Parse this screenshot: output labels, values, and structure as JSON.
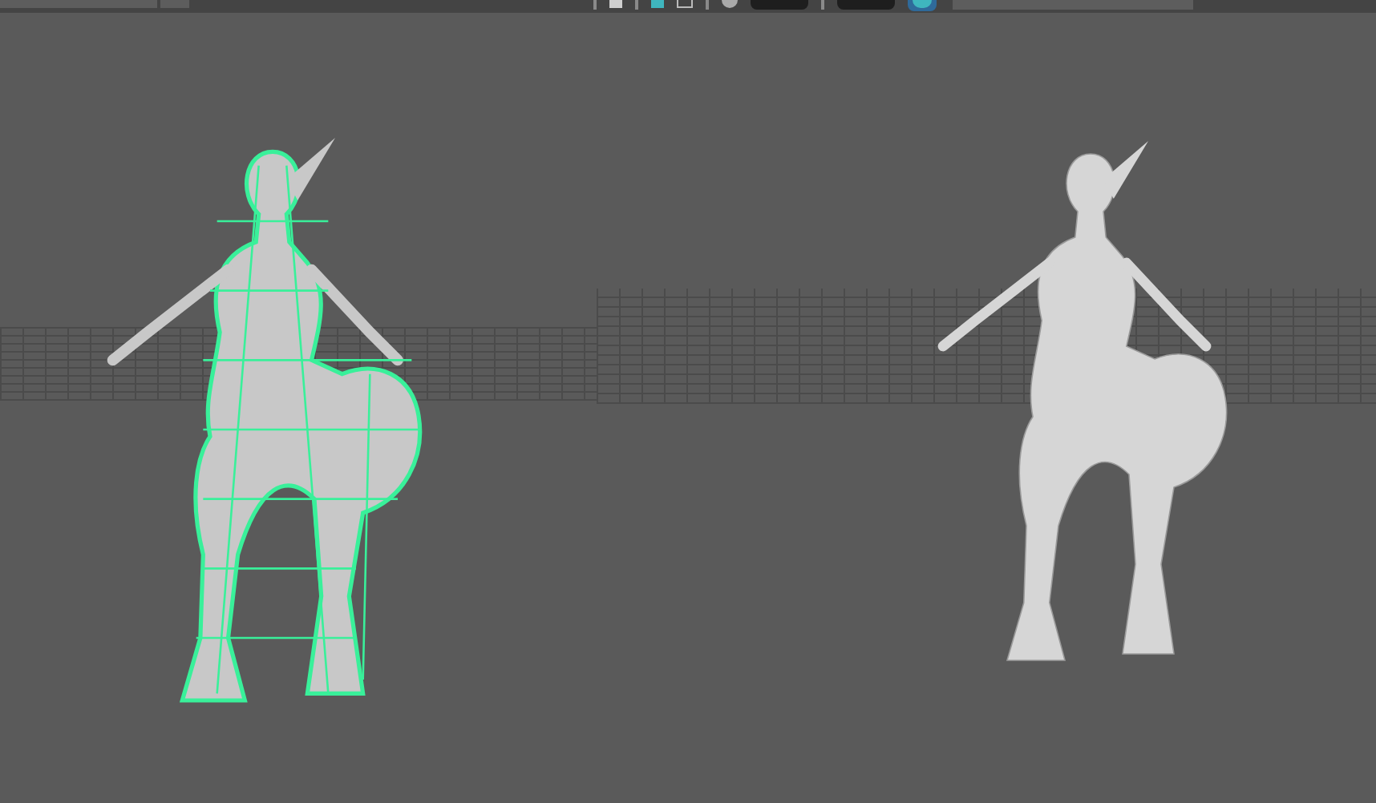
{
  "toolbar": {
    "left_field": {
      "kind": "field"
    },
    "tools": [
      {
        "kind": "pin"
      },
      {
        "kind": "swatch"
      },
      {
        "kind": "pin"
      },
      {
        "kind": "swatch-teal"
      },
      {
        "kind": "frame"
      },
      {
        "kind": "pin"
      },
      {
        "kind": "knob"
      },
      {
        "kind": "field"
      },
      {
        "kind": "pin"
      },
      {
        "kind": "field"
      },
      {
        "kind": "globe"
      },
      {
        "kind": "wide-field"
      }
    ]
  },
  "viewport": {
    "models": [
      {
        "kind": "wireframe"
      },
      {
        "kind": "shaded"
      }
    ]
  }
}
